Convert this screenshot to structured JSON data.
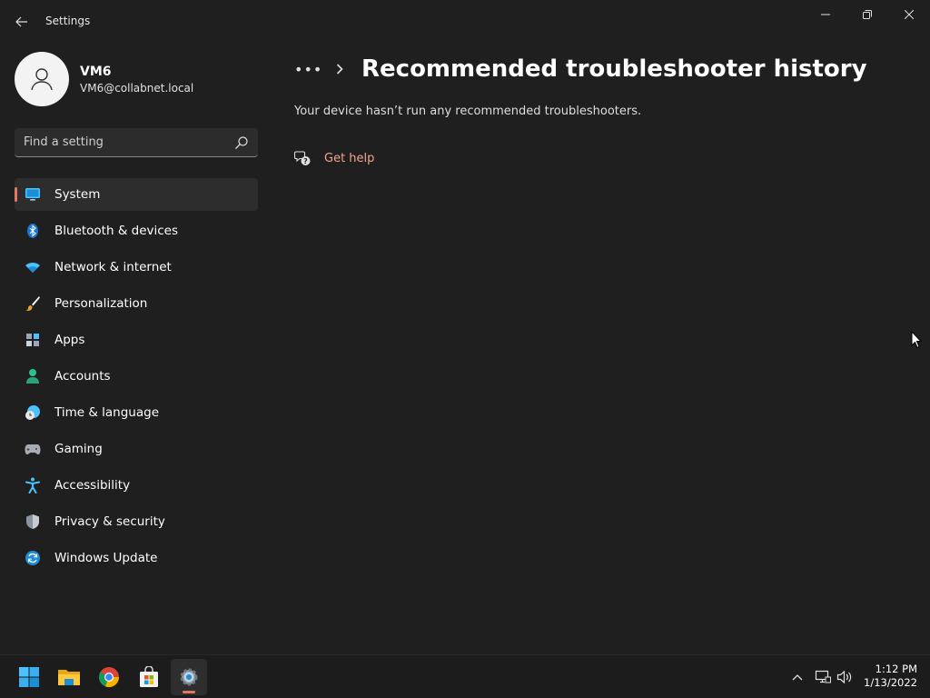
{
  "window": {
    "title": "Settings",
    "back_icon": "back-arrow-icon",
    "controls": [
      "minimize-icon",
      "maximize-icon",
      "close-icon"
    ]
  },
  "profile": {
    "name": "VM6",
    "email": "VM6@collabnet.local",
    "avatar_icon": "person-icon"
  },
  "search": {
    "placeholder": "Find a setting",
    "value": "",
    "icon": "search-icon"
  },
  "sidebar": {
    "items": [
      {
        "label": "System",
        "icon": "system-monitor-icon",
        "selected": true
      },
      {
        "label": "Bluetooth & devices",
        "icon": "bluetooth-icon"
      },
      {
        "label": "Network & internet",
        "icon": "wifi-icon"
      },
      {
        "label": "Personalization",
        "icon": "paintbrush-icon"
      },
      {
        "label": "Apps",
        "icon": "apps-icon"
      },
      {
        "label": "Accounts",
        "icon": "accounts-icon"
      },
      {
        "label": "Time & language",
        "icon": "clock-globe-icon"
      },
      {
        "label": "Gaming",
        "icon": "gamepad-icon"
      },
      {
        "label": "Accessibility",
        "icon": "accessibility-icon"
      },
      {
        "label": "Privacy & security",
        "icon": "shield-icon"
      },
      {
        "label": "Windows Update",
        "icon": "update-icon"
      }
    ]
  },
  "main": {
    "breadcrumb_overflow": "•••",
    "title": "Recommended troubleshooter history",
    "message": "Your device hasn’t run any recommended troubleshooters.",
    "get_help": {
      "label": "Get help",
      "icon": "help-chat-icon"
    }
  },
  "taskbar": {
    "apps": [
      "start-icon",
      "file-explorer-icon",
      "chrome-icon",
      "store-icon",
      "settings-gear-icon"
    ],
    "tray": [
      "chevron-up-icon",
      "network-icon",
      "volume-icon"
    ],
    "time": "1:12 PM",
    "date": "1/13/2022"
  },
  "colors": {
    "background": "#1f1f1f",
    "accent": "#e47763",
    "link": "#f0a58b"
  }
}
